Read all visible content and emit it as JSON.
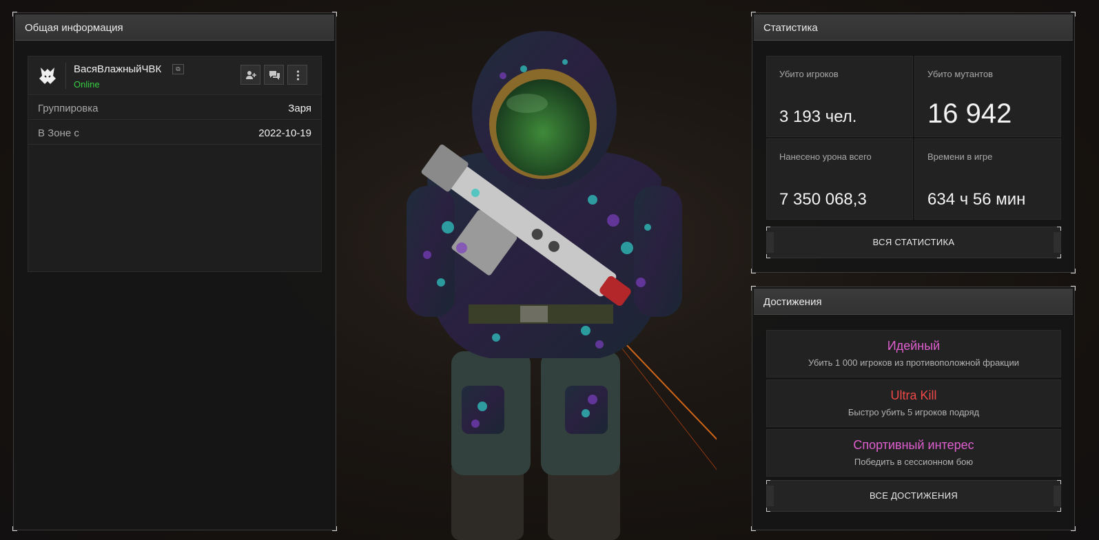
{
  "general_panel": {
    "title": "Общая информация",
    "player": {
      "nickname": "ВасяВлажныйЧВК",
      "status": "Online",
      "copy_icon": "copy-icon",
      "actions": [
        "add-friend-icon",
        "chat-icon",
        "more-vertical-icon"
      ]
    },
    "rows": [
      {
        "label": "Группировка",
        "value": "Заря"
      },
      {
        "label": "В Зоне с",
        "value": "2022-10-19"
      }
    ]
  },
  "stats_panel": {
    "title": "Статистика",
    "cells": [
      {
        "label": "Убито игроков",
        "value": "3 193 чел."
      },
      {
        "label": "Убито мутантов",
        "value": "16 942"
      },
      {
        "label": "Нанесено урона всего",
        "value": "7 350 068,3"
      },
      {
        "label": "Времени в игре",
        "value": "634 ч 56 мин"
      }
    ],
    "button_label": "ВСЯ СТАТИСТИКА"
  },
  "achievements_panel": {
    "title": "Достижения",
    "items": [
      {
        "title": "Идейный",
        "desc": "Убить 1 000 игроков из противоположной фракции",
        "color": "#e05fd0"
      },
      {
        "title": "Ultra Kill",
        "desc": "Быстро убить 5 игроков подряд",
        "color": "#f04848"
      },
      {
        "title": "Спортивный интерес",
        "desc": "Победить в сессионном бою",
        "color": "#e05fd0"
      }
    ],
    "button_label": "ВСЕ ДОСТИЖЕНИЯ"
  },
  "colors": {
    "online": "#35d042",
    "accent_pink": "#e05fd0",
    "accent_red": "#f04848"
  }
}
